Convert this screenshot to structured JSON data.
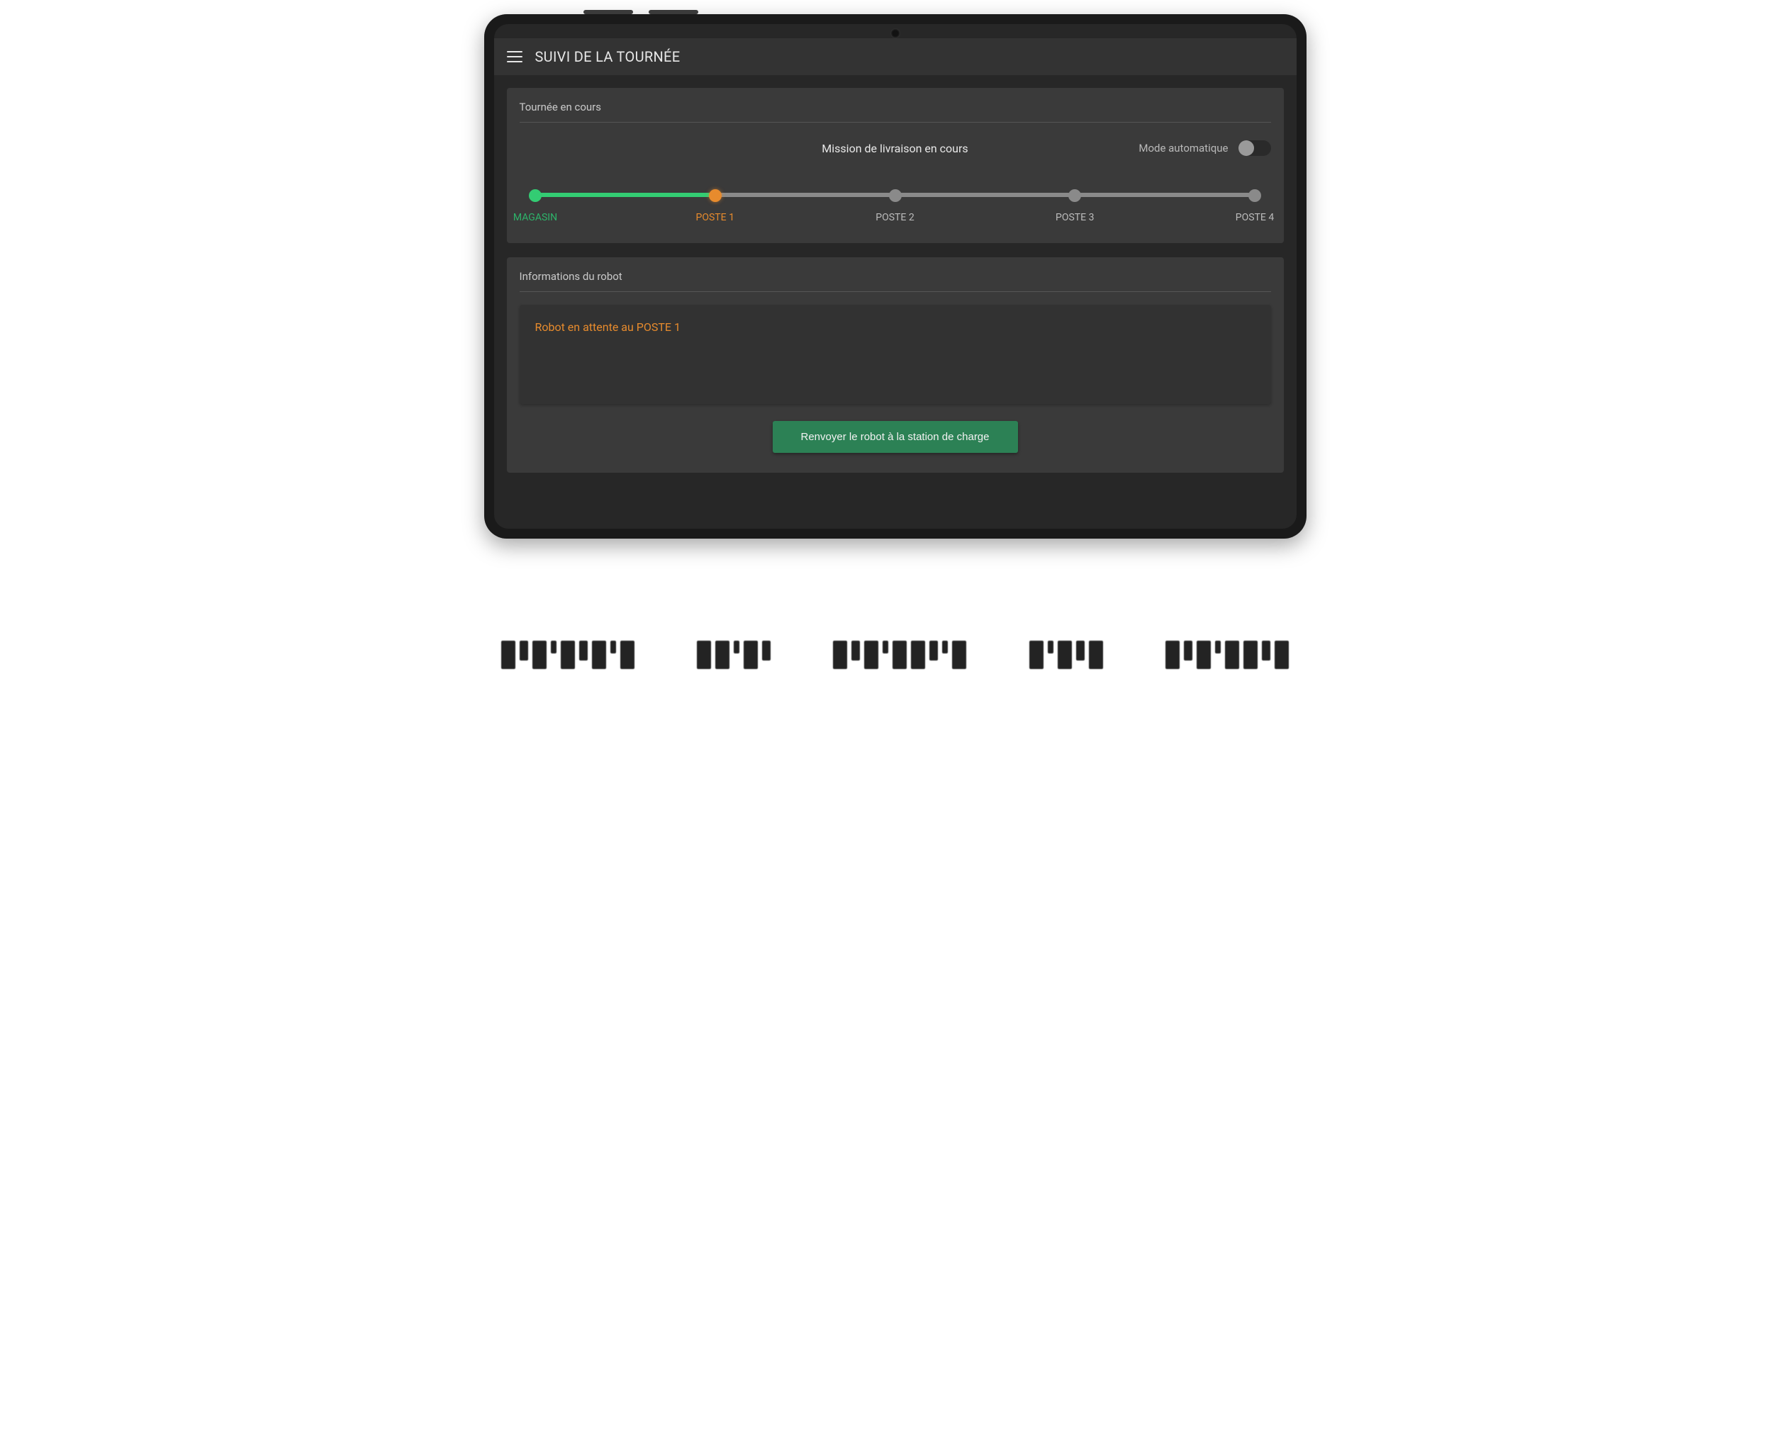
{
  "colors": {
    "green": "#33cc73",
    "orange": "#e78b2d",
    "grey_dot": "#8a8a8a",
    "button_bg": "#2c8155"
  },
  "header": {
    "title": "SUIVI DE LA TOURNÉE"
  },
  "tour_card": {
    "title": "Tournée en cours",
    "mission_status": "Mission de livraison en cours",
    "mode_label": "Mode automatique",
    "mode_on": false,
    "steps": [
      {
        "label": "MAGASIN",
        "state": "done"
      },
      {
        "label": "POSTE 1",
        "state": "current"
      },
      {
        "label": "POSTE 2",
        "state": "pending"
      },
      {
        "label": "POSTE 3",
        "state": "pending"
      },
      {
        "label": "POSTE 4",
        "state": "pending"
      }
    ]
  },
  "robot_card": {
    "title": "Informations du robot",
    "status": "Robot en attente au POSTE 1",
    "return_button": "Renvoyer le robot à la station de charge"
  }
}
